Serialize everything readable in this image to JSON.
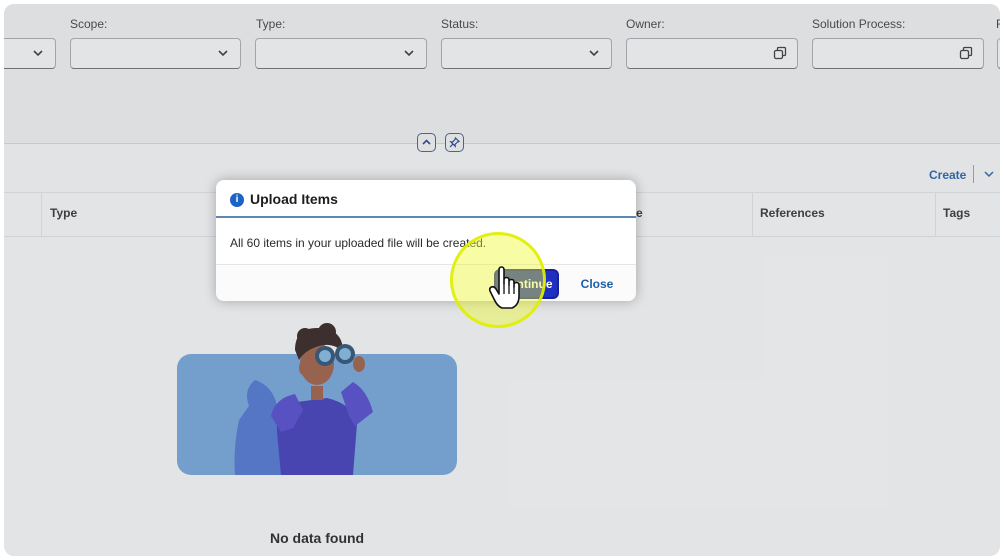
{
  "filters": {
    "scope_label": "Scope:",
    "type_label": "Type:",
    "status_label": "Status:",
    "owner_label": "Owner:",
    "solution_process_label": "Solution Process:",
    "cut_label": "F"
  },
  "table": {
    "create_label": "Create",
    "columns": {
      "type": "Type",
      "partial": "e",
      "references": "References",
      "tags": "Tags"
    },
    "empty_text": "No data found"
  },
  "dialog": {
    "title": "Upload Items",
    "message": "All 60 items in your uploaded file will be created.",
    "continue_label": "Continue",
    "close_label": "Close"
  },
  "colors": {
    "accent": "#1c5ea8",
    "primary_button": "#1f2fbf",
    "highlight": "#eef828"
  },
  "icons": [
    "chevron-down-icon",
    "value-help-icon",
    "collapse-up-icon",
    "pin-icon",
    "info-icon",
    "hand-cursor-icon"
  ]
}
